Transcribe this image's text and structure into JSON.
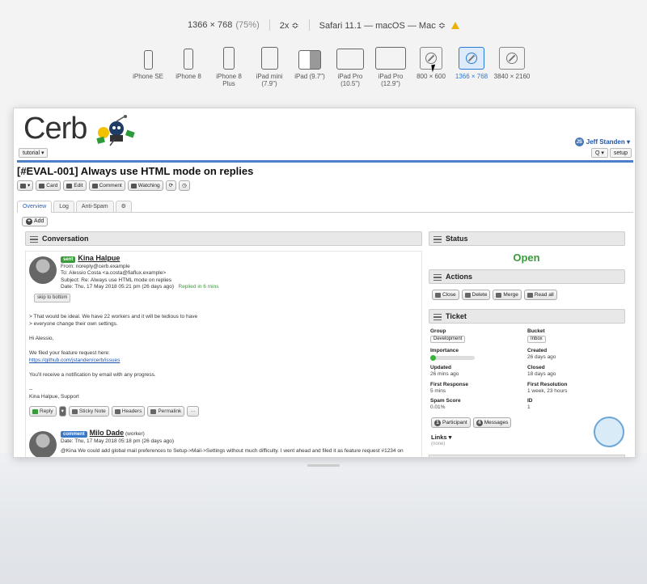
{
  "toolbar_top": {
    "resolution": "1366 × 768",
    "zoom": "(75%)",
    "scale": "2x ≎",
    "browser": "Safari 11.1 — macOS — Mac ≎"
  },
  "devices": [
    {
      "label": "iPhone SE",
      "kind": "phone"
    },
    {
      "label": "iPhone 8",
      "kind": "phone"
    },
    {
      "label": "iPhone 8 Plus",
      "kind": "phone"
    },
    {
      "label": "iPad mini (7.9\")",
      "kind": "tablet"
    },
    {
      "label": "iPad (9.7\")",
      "kind": "tablet"
    },
    {
      "label": "iPad Pro (10.5\")",
      "kind": "tablet"
    },
    {
      "label": "iPad Pro (12.9\")",
      "kind": "tablet"
    },
    {
      "label": "800 × 600",
      "kind": "desktop"
    },
    {
      "label": "1366 × 768",
      "kind": "desktop",
      "active": true
    },
    {
      "label": "3840 × 2160",
      "kind": "desktop"
    }
  ],
  "app": {
    "logo": "Cerb",
    "user": "Jeff Standen ▾",
    "user_initials": "JS",
    "workspace": "tutorial",
    "workspace_caret": "▾",
    "search": "Q ▾",
    "setup": "setup",
    "ticket_title": "[#EVAL-001] Always use HTML mode on replies",
    "toolbar": {
      "card": "Card",
      "edit": "Edit",
      "comment": "Comment",
      "watching": "Watching"
    },
    "tabs": [
      "Overview",
      "Log",
      "Anti-Spam",
      "⚙"
    ],
    "add": "Add",
    "conversation": "Conversation",
    "message1": {
      "badge": "sent",
      "name": "Kina Halpue",
      "from": "From: noreply@cerb.example",
      "to": "To: Alessio Costa <a.costa@fiaflux.example>",
      "subject": "Subject: Re: Always use HTML mode on replies",
      "date": "Date: Thu, 17 May 2018 05:21 pm (26 days ago)",
      "replied": "Replied in 6 mins",
      "skip": "skip to bottom",
      "quote1": "> That would be ideal. We have 22 workers and it will be tedious to have",
      "quote2": "> everyone change their own settings.",
      "greeting": "Hi Alessio,",
      "line1": "We filed your feature request here:",
      "link": "https://github.com/jstanden/cerb/issues",
      "line2": "You'll receive a notification by email with any progress.",
      "dashes": "--",
      "signature": "Kina Halpue, Support",
      "actions": [
        "Reply",
        "Sticky Note",
        "Headers",
        "Permalink",
        "···"
      ]
    },
    "message2": {
      "badge": "comment",
      "name": "Milo Dade",
      "role": "(worker)",
      "date": "Date: Thu, 17 May 2018 05:18 pm (26 days ago)",
      "text": "@Kina We could add global mail preferences to Setup->Mail->Settings without much difficulty. I went ahead and filed it as feature request #1234 on"
    },
    "status_header": "Status",
    "status": "Open",
    "actions_header": "Actions",
    "actions": [
      "Close",
      "Delete",
      "Merge",
      "Read all"
    ],
    "ticket_header": "Ticket",
    "ticket_fields": [
      {
        "key": "Group",
        "value": "Development",
        "pill": true
      },
      {
        "key": "Bucket",
        "value": "Inbox",
        "pill": true
      },
      {
        "key": "Importance",
        "value": "",
        "bar": 0.1
      },
      {
        "key": "Created",
        "value": "26 days ago"
      },
      {
        "key": "Updated",
        "value": "26 mins ago"
      },
      {
        "key": "Closed",
        "value": "18 days ago"
      },
      {
        "key": "First Response",
        "value": "5 mins"
      },
      {
        "key": "First Resolution",
        "value": "1 week, 23 hours"
      },
      {
        "key": "Spam Score",
        "value": "0.01%"
      },
      {
        "key": "ID",
        "value": "1"
      }
    ],
    "participant": "Participant",
    "participant_count": "1",
    "messages": "Messages",
    "messages_count": "4",
    "links": "Links ▾",
    "links_value": "(none)"
  }
}
